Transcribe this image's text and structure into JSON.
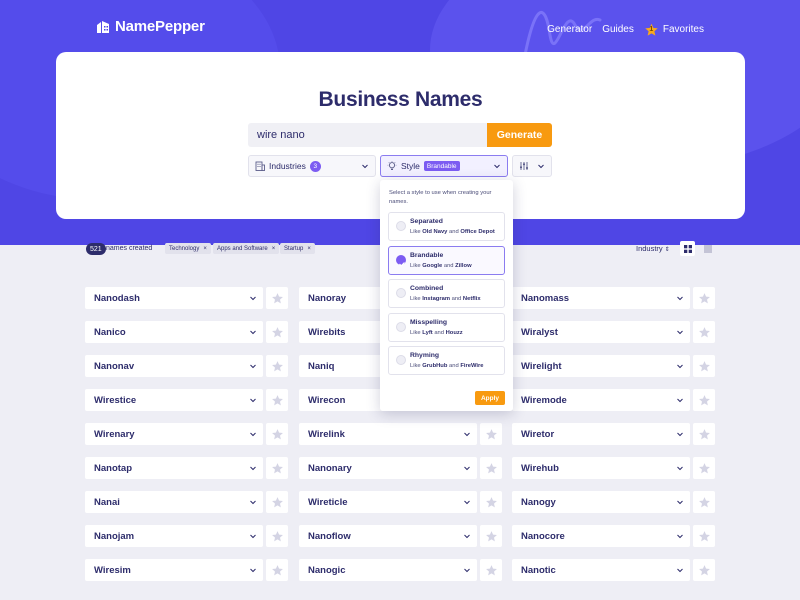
{
  "app": {
    "name": "NamePepper"
  },
  "nav": {
    "generator": "Generator",
    "guides": "Guides",
    "favorites": "Favorites",
    "favorites_count": "1"
  },
  "page": {
    "title": "Business Names"
  },
  "search": {
    "value": "wire nano",
    "button": "Generate"
  },
  "filters": {
    "industries": {
      "label": "Industries",
      "count": "3"
    },
    "style": {
      "label": "Style",
      "tag": "Brandable"
    }
  },
  "style_dropdown": {
    "intro": "Select a style to use when creating your names.",
    "options": [
      {
        "title": "Separated",
        "like": "Like",
        "ex1": "Old Navy",
        "and": "and",
        "ex2": "Office Depot",
        "selected": false
      },
      {
        "title": "Brandable",
        "like": "Like",
        "ex1": "Google",
        "and": "and",
        "ex2": "Zillow",
        "selected": true
      },
      {
        "title": "Combined",
        "like": "Like",
        "ex1": "Instagram",
        "and": "and",
        "ex2": "Netflix",
        "selected": false
      },
      {
        "title": "Misspelling",
        "like": "Like",
        "ex1": "Lyft",
        "and": "and",
        "ex2": "Houzz",
        "selected": false
      },
      {
        "title": "Rhyming",
        "like": "Like",
        "ex1": "GrubHub",
        "and": "and",
        "ex2": "FireWire",
        "selected": false
      }
    ],
    "apply": "Apply"
  },
  "results": {
    "count": "521",
    "count_label": "names created",
    "tags": [
      "Technology",
      "Apps and Software",
      "Startup"
    ],
    "sort": "Industry",
    "columns": [
      [
        "Nanodash",
        "Nanico",
        "Nanonav",
        "Wirestice",
        "Wirenary",
        "Nanotap",
        "Nanai",
        "Nanojam",
        "Wiresim"
      ],
      [
        "Nanoray",
        "Wirebits",
        "Naniq",
        "Wirecon",
        "Wirelink",
        "Nanonary",
        "Wireticle",
        "Nanoflow",
        "Nanogic"
      ],
      [
        "Nanomass",
        "Wiralyst",
        "Wirelight",
        "Wiremode",
        "Wiretor",
        "Wirehub",
        "Nanogy",
        "Nanocore",
        "Nanotic"
      ]
    ]
  },
  "colors": {
    "brand": "#4f46e5",
    "accent": "#f89a10",
    "purple": "#7c5cf2",
    "text": "#2d2c6b"
  }
}
